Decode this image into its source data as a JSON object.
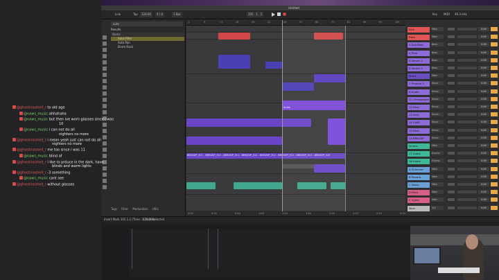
{
  "window": {
    "title": "Untitled"
  },
  "toolbar": {
    "link": "Link",
    "tap": "Tap",
    "tempo": "124.00",
    "signature": "4 / 4",
    "bar": "1 Bar",
    "position": "105 . 1 . 1",
    "key": "Key",
    "midi": "MIDI",
    "cpu": "49.3 kHz"
  },
  "browser": {
    "search_value": "auto",
    "label": "Results",
    "column_header": "Name",
    "items": [
      "Auto Filter",
      "Auto Pan",
      "Drum Rack"
    ],
    "tags": [
      "Tags",
      "Filter",
      "Modulation",
      "Utils"
    ]
  },
  "ruler": [
    "1",
    "9",
    "17",
    "25",
    "33",
    "41",
    "49",
    "57",
    "65",
    "73",
    "81",
    "89",
    "97",
    "105"
  ],
  "timeaxis": [
    "0:00",
    "0:20",
    "0:40",
    "1:00",
    "1:20",
    "1:40",
    "2:00",
    "2:20",
    "2:40",
    "3:00"
  ],
  "clips": {
    "vocal_label": "BRKVDP_311 - BRKVDP_311 - BRKVDP_311 - BRKVDP_311 - BRKVDP_312 - BRKVDP_312 - BRKVDP_313 - BRKVDP_315",
    "audio_label": "Audio"
  },
  "mixer": {
    "tracks": [
      {
        "name": "Kick",
        "route": "Main",
        "value": "0.00",
        "color": "#e25656"
      },
      {
        "name": "Bass",
        "route": "Main",
        "value": "0.00",
        "color": "#e25656"
      },
      {
        "name": "3 Sub Bass",
        "route": "Bass",
        "value": "0.00",
        "color": "#8c6bd6"
      },
      {
        "name": "4 Diva",
        "route": "Bass",
        "value": "0.00",
        "color": "#8c6bd6"
      },
      {
        "name": "5 Serum 2",
        "route": "Bass",
        "value": "0.00",
        "color": "#8c6bd6"
      },
      {
        "name": "6 Serum 3",
        "route": "Bass",
        "value": "0.00",
        "color": "#8c6bd6"
      },
      {
        "name": "Music",
        "route": "Main",
        "value": "0.00",
        "color": "#6a4ec2"
      },
      {
        "name": "7 Prophet 5",
        "route": "Music",
        "value": "0.00",
        "color": "#8c6bd6"
      },
      {
        "name": "8 Audio",
        "route": "Music",
        "value": "0.00",
        "color": "#8c6bd6"
      },
      {
        "name": "11 Omnisphere",
        "route": "Music",
        "value": "0.00",
        "color": "#8c6bd6"
      },
      {
        "name": "12 Diva",
        "route": "Music",
        "value": "0.00",
        "color": "#8c6bd6"
      },
      {
        "name": "13 Diva",
        "route": "Music",
        "value": "0.00",
        "color": "#8c6bd6"
      },
      {
        "name": "14 LABS",
        "route": "Music",
        "value": "0.00",
        "color": "#8c6bd6"
      },
      {
        "name": "15 Diva",
        "route": "Music",
        "value": "0.00",
        "color": "#8c6bd6"
      },
      {
        "name": "14 BRKVDP",
        "route": "Music",
        "value": "0.00",
        "color": "#8c6bd6"
      },
      {
        "name": "Drums",
        "route": "Main",
        "value": "0.00",
        "color": "#3fb89a"
      },
      {
        "name": "17 Audio",
        "route": "Drums",
        "value": "0.00",
        "color": "#3fb89a"
      },
      {
        "name": "18 Audio",
        "route": "Drums",
        "value": "0.00",
        "color": "#3fb89a"
      },
      {
        "name": "A Shimmer",
        "route": "Main",
        "value": "0.00",
        "color": "#6aa0d8"
      },
      {
        "name": "B Reverb",
        "route": "Main",
        "value": "0.00",
        "color": "#6aa0d8"
      },
      {
        "name": "C Delay",
        "route": "Main",
        "value": "0.00",
        "color": "#6aa0d8"
      },
      {
        "name": "D Pitch",
        "route": "Main",
        "value": "0.00",
        "color": "#d65f8a"
      },
      {
        "name": "E Hyper",
        "route": "Main",
        "value": "0.00",
        "color": "#d65f8a"
      },
      {
        "name": "Main",
        "route": "1/2",
        "value": "0.00",
        "color": "#bbbbbb"
      }
    ]
  },
  "statusbar": {
    "text": "Insert Mark 105.1.1 (Time: 3:21:306)",
    "selection": "1 Item selected"
  },
  "chat": [
    {
      "user": "@ghostinashell_r",
      "color": "red",
      "text": "to old age",
      "indent": false
    },
    {
      "user": "@naws_music",
      "color": "green",
      "text": "ahhahaha",
      "indent": true
    },
    {
      "user": "@naws_music",
      "color": "green",
      "text": "but then ive worn glasses since i was",
      "cont": "10",
      "indent": true
    },
    {
      "user": "@naws_music",
      "color": "green",
      "text": "i can not do all",
      "cont": "nighters no more",
      "indent": true
    },
    {
      "user": "@ghostinashell_r",
      "color": "red",
      "text": "i mean yeah just can not do all",
      "cont": "nighters no more",
      "indent": false
    },
    {
      "user": "@ghostinashell_r",
      "color": "red",
      "text": "me too since i was 11",
      "indent": false
    },
    {
      "user": "@naws_music",
      "color": "green",
      "text": "blind af",
      "indent": true
    },
    {
      "user": "@ghostinashell_r",
      "color": "red",
      "text": "i like to prduce in the dark, have",
      "cont": "blinds and warm lights",
      "indent": false
    },
    {
      "user": "@ghostinashell_r",
      "color": "red",
      "text": "-3 something",
      "indent": false
    },
    {
      "user": "@naws_music",
      "color": "green",
      "text": "cant see",
      "indent": true
    },
    {
      "user": "@ghostinashell_r",
      "color": "red",
      "text": "without glasses",
      "indent": false
    }
  ],
  "webcam": {
    "label": "Main"
  }
}
